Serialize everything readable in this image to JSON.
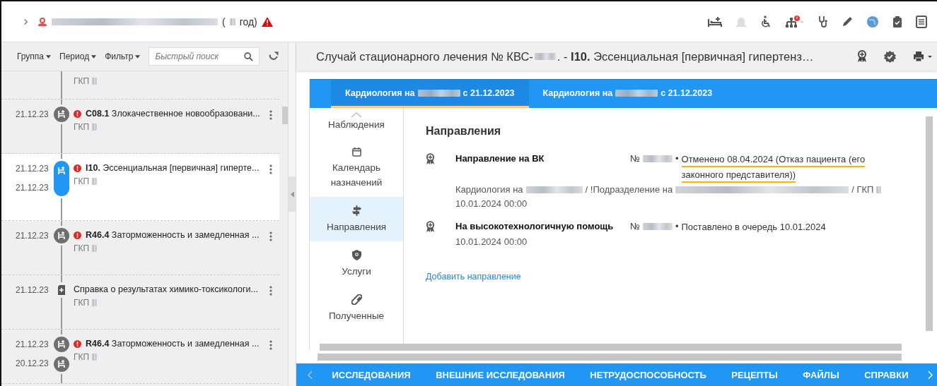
{
  "header": {
    "age_prefix": "(",
    "age_suffix": "год)"
  },
  "toolbar": {
    "filters": [
      "Группа",
      "Период",
      "Фильтр"
    ],
    "search": {
      "placeholder": "Быстрый поиск"
    }
  },
  "timeline": [
    {
      "selected": false,
      "org": "ГКП"
    },
    {
      "kind": "hospital",
      "dates": [
        "21.12.23"
      ],
      "selected": false,
      "alert": true,
      "code": "C08.1",
      "title": "Злокачественное новообразовани...",
      "org": "ГКП"
    },
    {
      "kind": "hospital",
      "dates": [
        "21.12.23",
        "21.12.23"
      ],
      "selected": true,
      "alert": true,
      "code": "I10.",
      "title": "Эссенциальная [первичная] гиперте...",
      "org": "ГКП"
    },
    {
      "kind": "hospital",
      "dates": [
        "21.12.23"
      ],
      "selected": false,
      "alert": true,
      "code": "R46.4",
      "title": "Заторможенность и замедленная ...",
      "org": "ГКП"
    },
    {
      "kind": "document",
      "dates": [
        "21.12.23"
      ],
      "selected": false,
      "alert": false,
      "title": "Справка о результатах химико-токсикологи...",
      "org": "ГКП"
    },
    {
      "kind": "hospital",
      "dates": [
        "21.12.23",
        "20.12.23"
      ],
      "selected": false,
      "alert": true,
      "code": "R46.4",
      "title": "Заторможенность и замедленная ...",
      "org": "ГКП"
    }
  ],
  "case": {
    "title_prefix": "Случай стационарного лечения № КВС-",
    "title_rest": ". - **I10.** Эссенциальная [первичная] гипертенз…"
  },
  "tabs": [
    {
      "label_prefix": "Кардиология на",
      "label_suffix": "с 21.12.2023",
      "selected": true
    },
    {
      "label_prefix": "Кардиология на",
      "label_suffix": "с 21.12.2023",
      "selected": false
    }
  ],
  "side_nav": [
    {
      "kind": "observations",
      "label": "Наблюдения",
      "selected": false
    },
    {
      "kind": "calendar",
      "label": "Календарь назначений",
      "selected": false
    },
    {
      "kind": "directions",
      "label": "Направления",
      "selected": true
    },
    {
      "kind": "services",
      "label": "Услуги",
      "selected": false
    },
    {
      "kind": "medicines",
      "label": "Полученные",
      "selected": false
    }
  ],
  "section_title": "Направления",
  "directions": [
    {
      "title": "Направление на ВК",
      "number_prefix": "№",
      "separator": "•",
      "status": "Отменено 08.04.2024 (Отказ пациента (его законного представителя))",
      "underlined": true,
      "details": [
        "Кардиология на",
        "/ !Подразделение на",
        "/ ГКП"
      ],
      "date": "10.01.2024 00:00"
    },
    {
      "title": "На высокотехнологичную помощь",
      "number_prefix": "№",
      "separator": "•",
      "status": "Поставлено в очередь 10.01.2024",
      "underlined": false,
      "date": "10.01.2024 00:00"
    }
  ],
  "add_link": "Добавить направление",
  "bottom_tabs": [
    "ИССЛЕДОВАНИЯ",
    "ВНЕШНИЕ ИССЛЕДОВАНИЯ",
    "НЕТРУДОСПОСОБНОСТЬ",
    "РЕЦЕПТЫ",
    "ФАЙЛЫ",
    "СПРАВКИ"
  ]
}
